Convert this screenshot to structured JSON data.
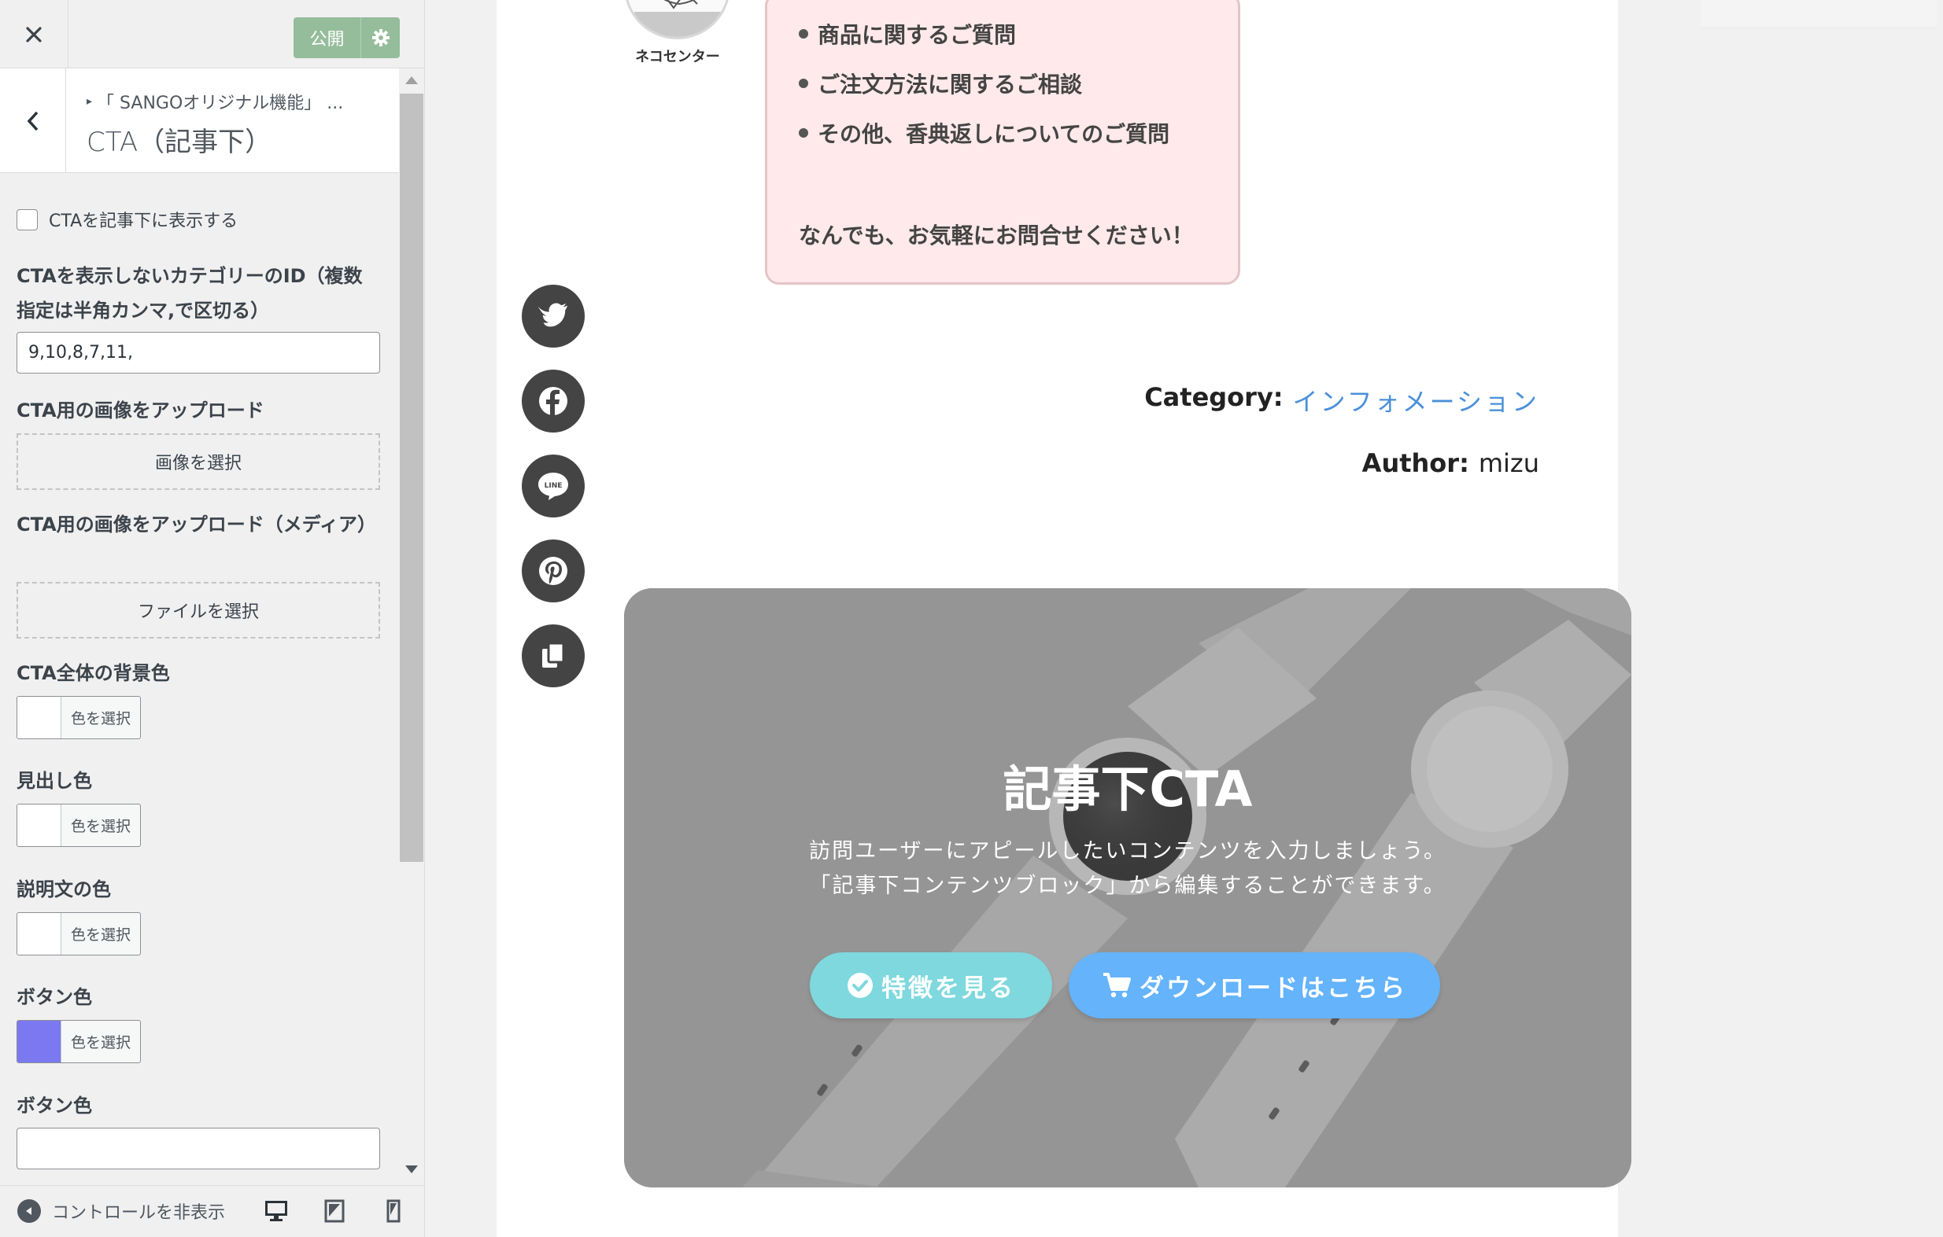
{
  "topbar": {
    "publish_label": "公開"
  },
  "section": {
    "breadcrumb": "「 SANGOオリジナル機能」 ...",
    "title": "CTA（記事下）"
  },
  "controls": {
    "show_cta_label": "CTAを記事下に表示する",
    "exclude_ids_label": "CTAを表示しないカテゴリーのID（複数指定は半角カンマ,で区切る）",
    "exclude_ids_value": "9,10,8,7,11,",
    "image_upload_label": "CTA用の画像をアップロード",
    "image_upload_button": "画像を選択",
    "media_upload_label": "CTA用の画像をアップロード（メディア）",
    "media_upload_button": "ファイルを選択",
    "bg_color_label": "CTA全体の背景色",
    "heading_color_label": "見出し色",
    "desc_color_label": "説明文の色",
    "button_color_label": "ボタン色",
    "button_color2_label": "ボタン色",
    "color_select_text": "色を選択",
    "button_color_value": "#7b78f2"
  },
  "footer": {
    "hide_controls_label": "コントロールを非表示"
  },
  "preview": {
    "avatar_name": "ネコセンター",
    "bubble_items": [
      "商品に関するご質問",
      "ご注文方法に関するご相談",
      "その他、香典返しについてのご質問"
    ],
    "bubble_note": "なんでも、お気軽にお問合せください！",
    "category_key": "Category:",
    "category_value": "インフォメーション",
    "author_key": "Author:",
    "author_value": "mizu",
    "cta_title": "記事下CTA",
    "cta_desc1": "訪問ユーザーにアピールしたいコンテンツを入力しましょう。",
    "cta_desc2": "「記事下コンテンツブロック」から編集することができます。",
    "cta_button1": "特徴を見る",
    "cta_button2": "ダウンロードはこちら"
  },
  "colors": {
    "publish": "#95bd9b",
    "cta_button1": "#7ed8de",
    "cta_button2": "#64b3fb",
    "link": "#4a90d9"
  }
}
